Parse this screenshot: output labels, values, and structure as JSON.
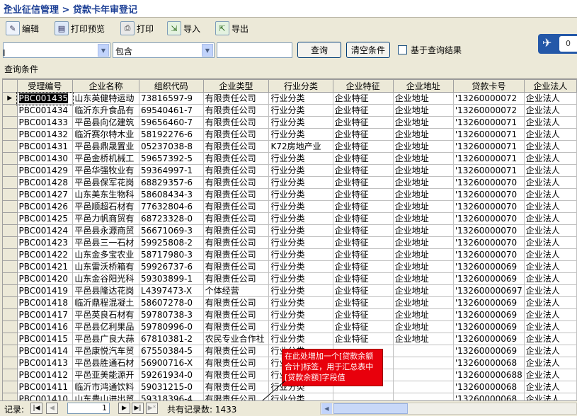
{
  "window": {
    "title": "企业征信管理 > 贷款卡年审登记",
    "arrow": ">"
  },
  "toolbar": {
    "edit": "编辑",
    "preview": "打印预览",
    "print": "打印",
    "import": "导入",
    "export": "导出"
  },
  "filter": {
    "field_value": "",
    "operator_value": "包含",
    "query_value": "",
    "query_button": "查询",
    "clear_button": "清空条件",
    "based_on_results": "基于查询结果",
    "cursor": "I"
  },
  "side_widget": {
    "number": "0"
  },
  "query_condition_label": "查询条件",
  "grid": {
    "columns": [
      "受理编号",
      "企业名称",
      "组织代码",
      "企业类型",
      "行业分类",
      "企业特征",
      "企业地址",
      "贷款卡号",
      "企业法人"
    ],
    "rows": [
      [
        "PBC001435",
        "山东英健特运动",
        "73816597-9",
        "有限责任公司",
        "行业分类",
        "企业特征",
        "企业地址",
        "'13260000072",
        "企业法人"
      ],
      [
        "PBC001434",
        "临沂东升食品有",
        "69540461-7",
        "有限责任公司",
        "行业分类",
        "企业特征",
        "企业地址",
        "'13260000072",
        "企业法人"
      ],
      [
        "PBC001433",
        "平邑县向亿建筑",
        "59656460-7",
        "有限责任公司",
        "行业分类",
        "企业特征",
        "企业地址",
        "'13260000071",
        "企业法人"
      ],
      [
        "PBC001432",
        "临沂赛尔特木业",
        "58192276-6",
        "有限责任公司",
        "行业分类",
        "企业特征",
        "企业地址",
        "'13260000071",
        "企业法人"
      ],
      [
        "PBC001431",
        "平邑县鼎晟置业",
        "05237038-8",
        "有限责任公司",
        "K72房地产业",
        "企业特征",
        "企业地址",
        "'13260000071",
        "企业法人"
      ],
      [
        "PBC001430",
        "平邑金桥机械工",
        "59657392-5",
        "有限责任公司",
        "行业分类",
        "企业特征",
        "企业地址",
        "'13260000071",
        "企业法人"
      ],
      [
        "PBC001429",
        "平邑华强牧业有",
        "59364997-1",
        "有限责任公司",
        "行业分类",
        "企业特征",
        "企业地址",
        "'13260000071",
        "企业法人"
      ],
      [
        "PBC001428",
        "平邑县保军花岗",
        "68829357-6",
        "有限责任公司",
        "行业分类",
        "企业特征",
        "企业地址",
        "'13260000070",
        "企业法人"
      ],
      [
        "PBC001427",
        "山东美东生物科",
        "58608434-3",
        "有限责任公司",
        "行业分类",
        "企业特征",
        "企业地址",
        "'13260000070",
        "企业法人"
      ],
      [
        "PBC001426",
        "平邑顺超石材有",
        "77632804-6",
        "有限责任公司",
        "行业分类",
        "企业特征",
        "企业地址",
        "'13260000070",
        "企业法人"
      ],
      [
        "PBC001425",
        "平邑力帆商贸有",
        "68723328-0",
        "有限责任公司",
        "行业分类",
        "企业特征",
        "企业地址",
        "'13260000070",
        "企业法人"
      ],
      [
        "PBC001424",
        "平邑县永源商贸",
        "56671069-3",
        "有限责任公司",
        "行业分类",
        "企业特征",
        "企业地址",
        "'13260000070",
        "企业法人"
      ],
      [
        "PBC001423",
        "平邑县三一石材",
        "59925808-2",
        "有限责任公司",
        "行业分类",
        "企业特征",
        "企业地址",
        "'13260000070",
        "企业法人"
      ],
      [
        "PBC001422",
        "山东金多宝农业",
        "58717980-3",
        "有限责任公司",
        "行业分类",
        "企业特征",
        "企业地址",
        "'13260000070",
        "企业法人"
      ],
      [
        "PBC001421",
        "山东雷沃桥箱有",
        "59926737-6",
        "有限责任公司",
        "行业分类",
        "企业特征",
        "企业地址",
        "'13260000069",
        "企业法人"
      ],
      [
        "PBC001420",
        "山东金谷阳光科",
        "59303899-1",
        "有限责任公司",
        "行业分类",
        "企业特征",
        "企业地址",
        "'13260000069",
        "企业法人"
      ],
      [
        "PBC001419",
        "平邑县隆达花岗",
        "L4397473-X",
        "个体经营",
        "行业分类",
        "企业特征",
        "企业地址",
        "'132600000697",
        "企业法人"
      ],
      [
        "PBC001418",
        "临沂鼎程混凝土",
        "58607278-0",
        "有限责任公司",
        "行业分类",
        "企业特征",
        "企业地址",
        "'13260000069",
        "企业法人"
      ],
      [
        "PBC001417",
        "平邑英良石材有",
        "59780738-3",
        "有限责任公司",
        "行业分类",
        "企业特征",
        "企业地址",
        "'13260000069",
        "企业法人"
      ],
      [
        "PBC001416",
        "平邑县亿利果品",
        "59780996-0",
        "有限责任公司",
        "行业分类",
        "企业特征",
        "企业地址",
        "'13260000069",
        "企业法人"
      ],
      [
        "PBC001415",
        "平邑县广良大蒜",
        "67810381-2",
        "农民专业合作社",
        "行业分类",
        "企业特征",
        "企业地址",
        "'13260000069",
        "企业法人"
      ],
      [
        "PBC001414",
        "平邑康悦汽车贸",
        "67550384-5",
        "有限责任公司",
        "行业分类",
        "",
        "",
        "'13260000069",
        "企业法人"
      ],
      [
        "PBC001413",
        "平邑县胜通石材",
        "56900716-X",
        "有限责任公司",
        "行业分类",
        "",
        "",
        "'13260000068",
        "企业法人"
      ],
      [
        "PBC001412",
        "平邑亚美能源开",
        "59261934-0",
        "有限责任公司",
        "行业分类",
        "",
        "",
        "'132600000688",
        "企业法人"
      ],
      [
        "PBC001411",
        "临沂市鸿通饮料",
        "59031215-0",
        "有限责任公司",
        "行业分类",
        "",
        "",
        "'13260000068",
        "企业法人"
      ],
      [
        "PBC001410",
        "山东豊山进出贸",
        "59318396-4",
        "有限责任公司",
        "行业分类",
        "",
        "",
        "'13260000068",
        "企业法人"
      ]
    ]
  },
  "callout": {
    "text": "在此处增加一个[贷款余额合计]标签，用于汇总表中[贷款余额]字段值"
  },
  "status": {
    "label": "记录:",
    "record": "1",
    "total": "共有记录数: 1433"
  },
  "icons": {
    "edit": "edit-icon",
    "preview": "print-preview-icon",
    "print": "printer-icon",
    "import": "import-icon",
    "export": "export-icon",
    "plane": "paper-plane-icon"
  }
}
